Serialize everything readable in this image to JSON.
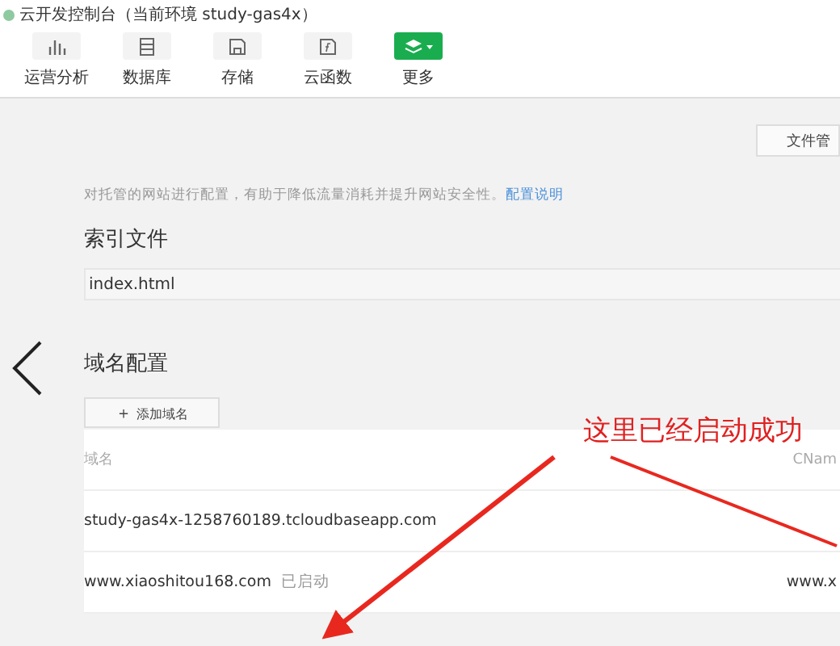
{
  "window": {
    "title": "云开发控制台（当前环境 study-gas4x）"
  },
  "toolbar": [
    {
      "label": "运营分析",
      "kind": "chart",
      "selected": false
    },
    {
      "label": "数据库",
      "kind": "database",
      "selected": false
    },
    {
      "label": "存储",
      "kind": "storage",
      "selected": false
    },
    {
      "label": "云函数",
      "kind": "function",
      "selected": false
    },
    {
      "label": "更多",
      "kind": "more",
      "selected": true
    }
  ],
  "file_button": "文件管",
  "description": {
    "text": "对托管的网站进行配置，有助于降低流量消耗并提升网站安全性。",
    "link": "配置说明"
  },
  "index_section": {
    "heading": "索引文件",
    "value": "index.html"
  },
  "domain_section": {
    "heading": "域名配置",
    "add_button": "添加域名",
    "add_icon": "＋",
    "columns": [
      "域名",
      "CNam"
    ],
    "rows": [
      {
        "domain": "study-gas4x-1258760189.tcloudbaseapp.com",
        "status": "",
        "cname": ""
      },
      {
        "domain": "www.xiaoshitou168.com",
        "status": "已启动",
        "cname": "www.x"
      }
    ]
  },
  "annotation": "这里已经启动成功"
}
